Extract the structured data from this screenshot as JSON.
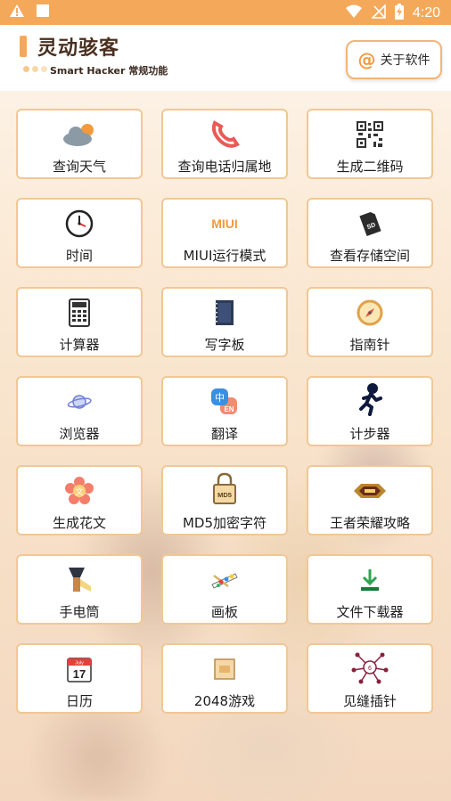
{
  "status_bar": {
    "time": "4:20"
  },
  "header": {
    "title": "灵动骇客",
    "subtitle": "Smart Hacker 常规功能",
    "about_label": "关于软件"
  },
  "colors": {
    "accent": "#f4a95a",
    "card_border": "#f1c795"
  },
  "features": [
    {
      "label": "查询天气",
      "icon": "weather-cloud-icon"
    },
    {
      "label": "查询电话归属地",
      "icon": "phone-icon"
    },
    {
      "label": "生成二维码",
      "icon": "qr-code-icon"
    },
    {
      "label": "时间",
      "icon": "clock-icon"
    },
    {
      "label": "MIUI运行模式",
      "icon": "miui-logo-icon",
      "icon_text": "MIUI"
    },
    {
      "label": "查看存储空间",
      "icon": "sd-card-icon",
      "icon_text": "SD"
    },
    {
      "label": "计算器",
      "icon": "calculator-icon"
    },
    {
      "label": "写字板",
      "icon": "notebook-icon"
    },
    {
      "label": "指南针",
      "icon": "compass-icon"
    },
    {
      "label": "浏览器",
      "icon": "browser-planet-icon"
    },
    {
      "label": "翻译",
      "icon": "translate-icon",
      "icon_text": "中",
      "icon_text2": "EN"
    },
    {
      "label": "计步器",
      "icon": "running-man-icon"
    },
    {
      "label": "生成花文",
      "icon": "flower-text-icon",
      "icon_text": "文"
    },
    {
      "label": "MD5加密字符",
      "icon": "md5-lock-icon",
      "icon_text": "MD5"
    },
    {
      "label": "王者荣耀攻略",
      "icon": "game-logo-icon"
    },
    {
      "label": "手电筒",
      "icon": "flashlight-icon"
    },
    {
      "label": "画板",
      "icon": "palette-icon"
    },
    {
      "label": "文件下载器",
      "icon": "download-icon"
    },
    {
      "label": "日历",
      "icon": "calendar-icon",
      "icon_text": "17",
      "icon_text2": "July"
    },
    {
      "label": "2048游戏",
      "icon": "game-2048-icon"
    },
    {
      "label": "见缝插针",
      "icon": "pin-game-icon",
      "icon_text": "6"
    }
  ]
}
